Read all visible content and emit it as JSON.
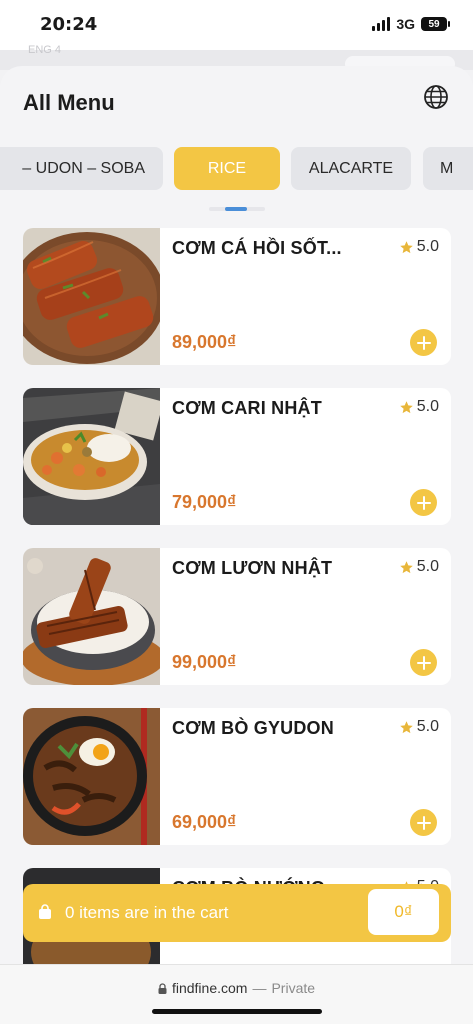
{
  "status_bar": {
    "time": "20:24",
    "network": "3G",
    "battery": "59"
  },
  "background": {
    "ghost_text": "ENG 4"
  },
  "header": {
    "title": "All Menu",
    "language_icon": "globe-icon"
  },
  "tabs": [
    {
      "label": "– UDON – SOBA",
      "active": false
    },
    {
      "label": "RICE",
      "active": true
    },
    {
      "label": "ALACARTE",
      "active": false
    },
    {
      "label": "M",
      "active": false
    }
  ],
  "menu_items": [
    {
      "name": "CƠM CÁ HỒI SỐT...",
      "rating": "5.0",
      "price": "89,000₫",
      "image": "salmon-teriyaki-photo"
    },
    {
      "name": "CƠM CARI NHẬT",
      "rating": "5.0",
      "price": "79,000₫",
      "image": "japanese-curry-photo"
    },
    {
      "name": "CƠM LƯƠN NHẬT",
      "rating": "5.0",
      "price": "99,000₫",
      "image": "unagi-rice-photo"
    },
    {
      "name": "CƠM BÒ GYUDON",
      "rating": "5.0",
      "price": "69,000₫",
      "image": "gyudon-photo"
    },
    {
      "name": "CƠM BÒ NƯỚNG",
      "rating": "5.0",
      "price": "",
      "image": "grilled-beef-photo"
    }
  ],
  "cart": {
    "text": "0 items are in the cart",
    "total": "0₫"
  },
  "browser": {
    "domain": "findfine.com",
    "separator": "—",
    "mode": "Private"
  },
  "colors": {
    "accent": "#f3c644",
    "price": "#d8772e",
    "tab_inactive": "#e4e5e9"
  }
}
